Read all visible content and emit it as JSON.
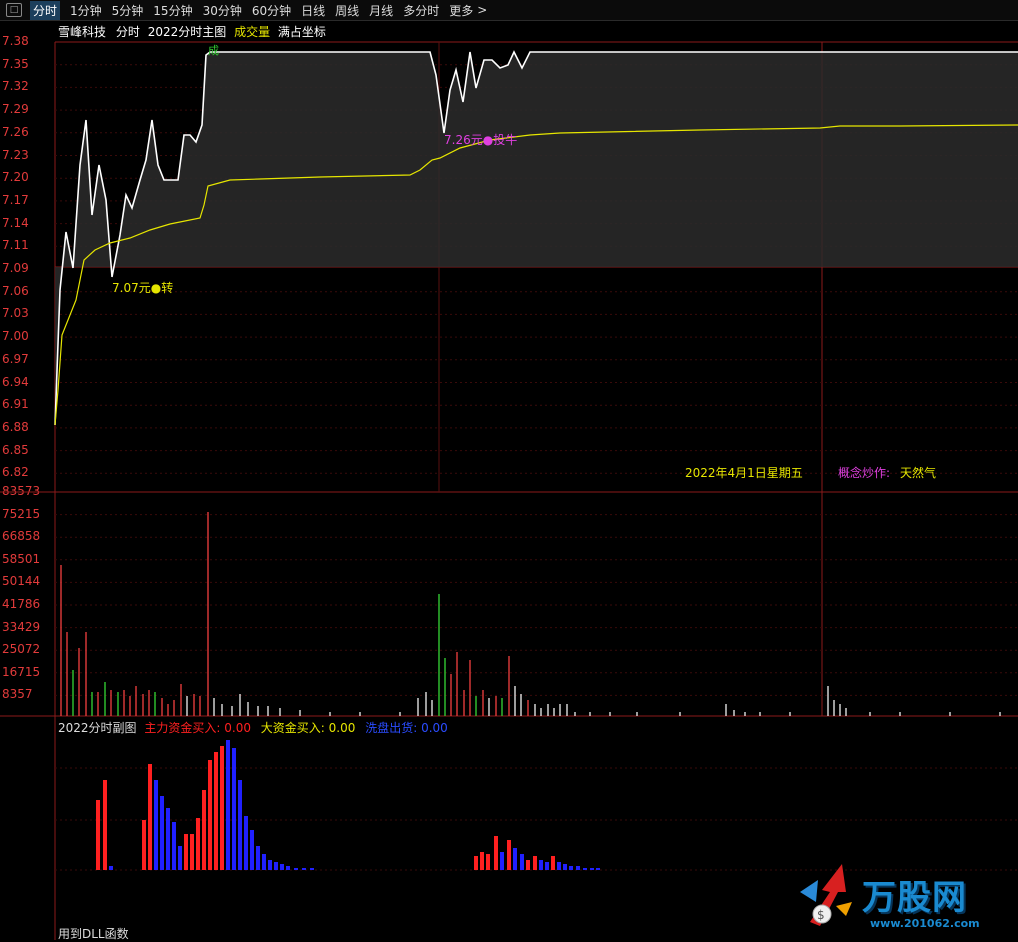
{
  "tabs": [
    "分时",
    "1分钟",
    "5分钟",
    "15分钟",
    "30分钟",
    "60分钟",
    "日线",
    "周线",
    "月线",
    "多分时",
    "更多"
  ],
  "active_tab": 0,
  "main": {
    "stock_name": "雪峰科技",
    "mode": "分时",
    "indicator": "2022分时主图",
    "volume_label": "成交量",
    "full_coord": "满占坐标",
    "buy_mark": "成",
    "y_ticks": [
      "7.38",
      "7.35",
      "7.32",
      "7.29",
      "7.26",
      "7.23",
      "7.20",
      "7.17",
      "7.14",
      "7.11",
      "7.09",
      "7.06",
      "7.03",
      "7.00",
      "6.97",
      "6.94",
      "6.91",
      "6.88",
      "6.85",
      "6.82"
    ],
    "annotation_low": "7.07元●转",
    "annotation_mid": "7.26元●投牛",
    "date_text": "2022年4月1日星期五",
    "concept_label": "概念炒作:",
    "concept_value": "天然气"
  },
  "volume": {
    "y_ticks": [
      "83573",
      "75215",
      "66858",
      "58501",
      "50144",
      "41786",
      "33429",
      "25072",
      "16715",
      "8357"
    ]
  },
  "sub": {
    "title": "2022分时副图",
    "main_buy_label": "主力资金买入:",
    "main_buy_value": "0.00",
    "big_buy_label": "大资金买入:",
    "big_buy_value": "0.00",
    "wash_label": "洗盘出货:",
    "wash_value": "0.00",
    "footer": "用到DLL函数"
  },
  "watermark": {
    "brand": "万股网",
    "url": "www.201062.com"
  },
  "colors": {
    "up": "#e23b3b",
    "down": "#32c832",
    "price_line": "#ffffff",
    "avg_line": "#e6e600",
    "sub_red": "#ff2020",
    "sub_blue": "#2020ff",
    "magenta": "#e040e0",
    "yellow": "#e6e600"
  }
}
